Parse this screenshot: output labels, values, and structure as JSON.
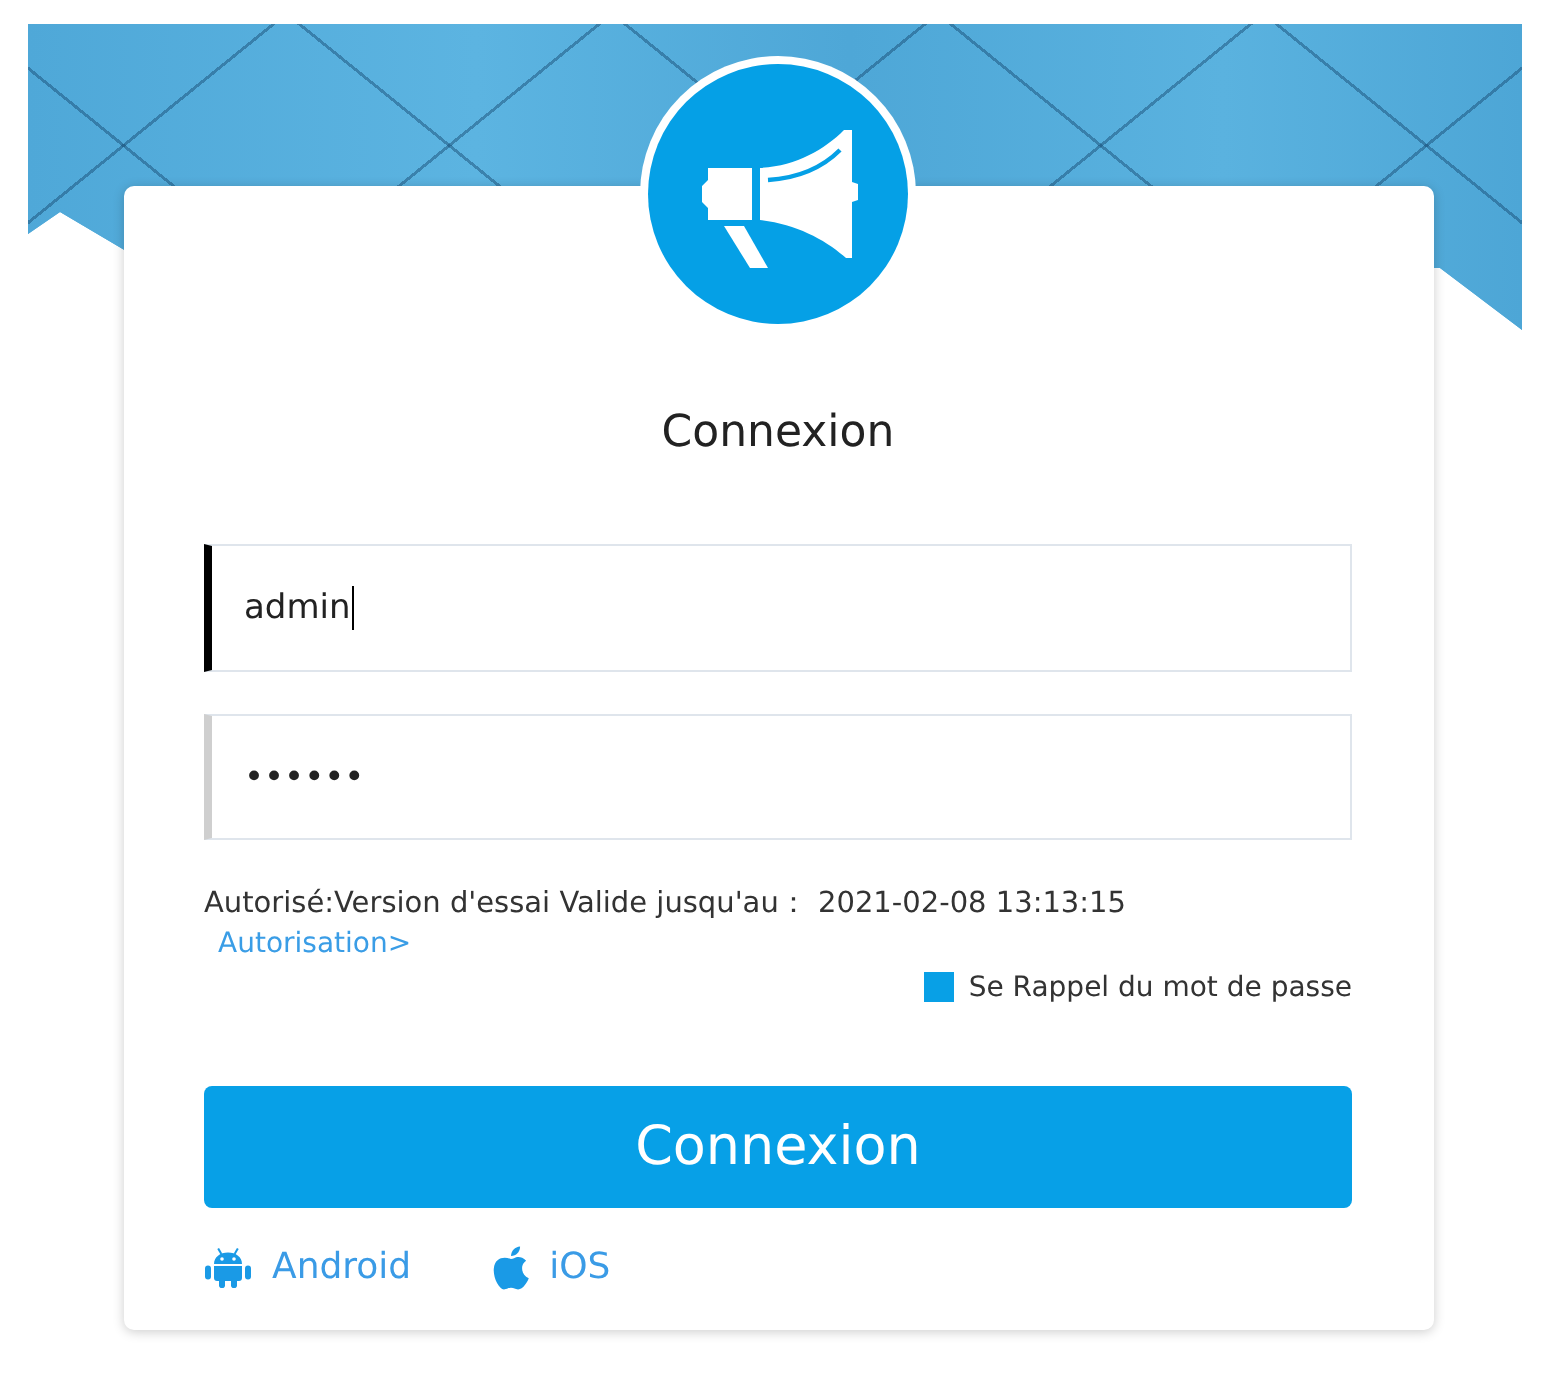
{
  "title": "Connexion",
  "username": {
    "value": "admin",
    "focused": true
  },
  "password": {
    "value": "••••••",
    "focused": false
  },
  "license": {
    "text": "Autorisé:Version d'essai Valide jusqu'au： 2021-02-08 13:13:15",
    "link": "Autorisation>"
  },
  "remember": {
    "label": "Se Rappel du mot de passe",
    "checked": true
  },
  "login_button": "Connexion",
  "app_links": [
    {
      "kind": "android",
      "label": "Android"
    },
    {
      "kind": "ios",
      "label": "iOS"
    }
  ]
}
